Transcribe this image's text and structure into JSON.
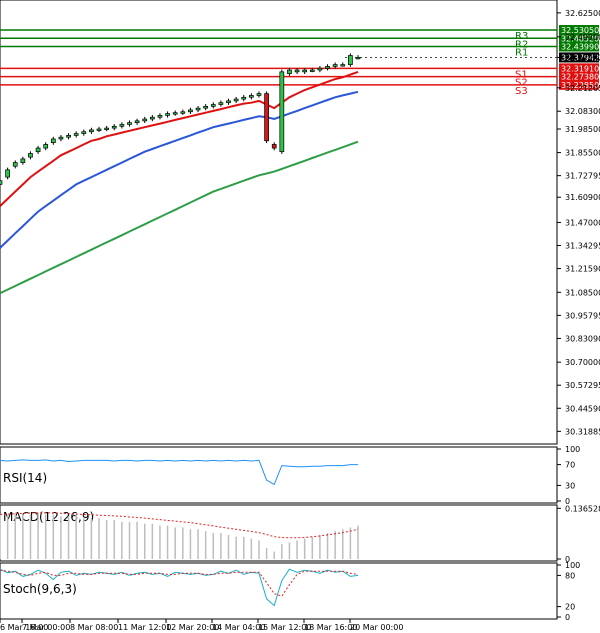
{
  "chart_data": {
    "type": "candlestick",
    "title": "",
    "main": {
      "ylim": [
        30.26,
        32.685
      ],
      "y_ticks": [
        "32.62500",
        "32.49300",
        "32.37942",
        "32.21205",
        "32.08300",
        "31.98500",
        "31.85500",
        "31.72795",
        "31.60900",
        "31.47000",
        "31.34295",
        "31.21590",
        "31.08500",
        "30.95795",
        "30.83090",
        "30.70000",
        "30.57295",
        "30.44590",
        "30.31885"
      ],
      "y_tick_values": [
        32.625,
        32.493,
        32.37942,
        32.21205,
        32.083,
        31.985,
        31.855,
        31.72795,
        31.609,
        31.47,
        31.34295,
        31.2159,
        31.085,
        30.95795,
        30.8309,
        30.7,
        30.57295,
        30.4459,
        30.31885
      ],
      "last_price": {
        "value": 32.37942,
        "label": "32.37942"
      },
      "levels": [
        {
          "name": "R3",
          "value": 32.5305,
          "label": "32.53050",
          "color": "#007a00"
        },
        {
          "name": "R2",
          "value": 32.4852,
          "label": "32.48520",
          "color": "#007a00"
        },
        {
          "name": "R1",
          "value": 32.4399,
          "label": "32.43990",
          "color": "#007a00"
        },
        {
          "name": "S1",
          "value": 32.3191,
          "label": "32.31910",
          "color": "#e01010"
        },
        {
          "name": "S2",
          "value": 32.2738,
          "label": "32.27380",
          "color": "#e01010"
        },
        {
          "name": "S3",
          "value": 32.2285,
          "label": "32.22850",
          "color": "#e01010"
        }
      ],
      "close": [
        31.7,
        31.76,
        31.8,
        31.82,
        31.85,
        31.88,
        31.9,
        31.93,
        31.94,
        31.95,
        31.96,
        31.97,
        31.98,
        31.985,
        31.99,
        32.0,
        32.01,
        32.02,
        32.03,
        32.04,
        32.05,
        32.06,
        32.07,
        32.075,
        32.08,
        32.09,
        32.1,
        32.11,
        32.12,
        32.13,
        32.14,
        32.15,
        32.16,
        32.17,
        32.18,
        31.92,
        31.88,
        32.3,
        32.31,
        32.31,
        32.31,
        32.31,
        32.32,
        32.33,
        32.34,
        32.34,
        32.39,
        32.38
      ],
      "open": [
        31.68,
        31.72,
        31.78,
        31.8,
        31.83,
        31.86,
        31.88,
        31.91,
        31.93,
        31.94,
        31.95,
        31.96,
        31.97,
        31.98,
        31.985,
        31.99,
        32.0,
        32.01,
        32.02,
        32.03,
        32.04,
        32.05,
        32.06,
        32.07,
        32.075,
        32.08,
        32.09,
        32.1,
        32.11,
        32.12,
        32.13,
        32.14,
        32.15,
        32.16,
        32.17,
        32.18,
        31.9,
        31.86,
        32.29,
        32.3,
        32.3,
        32.31,
        32.31,
        32.32,
        32.33,
        32.34,
        32.34,
        32.38
      ],
      "series": [
        {
          "name": "",
          "color": "#e01010",
          "values": [
            31.56,
            31.6,
            31.64,
            31.68,
            31.72,
            31.75,
            31.78,
            31.81,
            31.84,
            31.86,
            31.88,
            31.9,
            31.92,
            31.93,
            31.945,
            31.955,
            31.965,
            31.975,
            31.985,
            31.995,
            32.005,
            32.015,
            32.025,
            32.035,
            32.045,
            32.055,
            32.065,
            32.075,
            32.085,
            32.095,
            32.105,
            32.115,
            32.125,
            32.13,
            32.14,
            32.12,
            32.1,
            32.13,
            32.16,
            32.18,
            32.2,
            32.215,
            32.23,
            32.245,
            32.26,
            32.27,
            32.285,
            32.3
          ]
        },
        {
          "name": "",
          "color": "#2a56d8",
          "values": [
            31.33,
            31.37,
            31.41,
            31.45,
            31.49,
            31.53,
            31.56,
            31.59,
            31.62,
            31.65,
            31.68,
            31.7,
            31.72,
            31.74,
            31.76,
            31.78,
            31.8,
            31.82,
            31.84,
            31.86,
            31.875,
            31.89,
            31.905,
            31.92,
            31.935,
            31.95,
            31.965,
            31.98,
            31.995,
            32.005,
            32.015,
            32.025,
            32.035,
            32.045,
            32.055,
            32.05,
            32.04,
            32.055,
            32.07,
            32.085,
            32.1,
            32.115,
            32.13,
            32.145,
            32.16,
            32.17,
            32.18,
            32.19
          ]
        },
        {
          "name": "",
          "color": "#2e9e48",
          "values": [
            31.08,
            31.1,
            31.12,
            31.14,
            31.16,
            31.18,
            31.2,
            31.22,
            31.24,
            31.26,
            31.28,
            31.3,
            31.32,
            31.34,
            31.36,
            31.38,
            31.4,
            31.42,
            31.44,
            31.46,
            31.48,
            31.5,
            31.52,
            31.54,
            31.56,
            31.58,
            31.6,
            31.62,
            31.64,
            31.655,
            31.67,
            31.685,
            31.7,
            31.715,
            31.73,
            31.74,
            31.75,
            31.765,
            31.78,
            31.795,
            31.81,
            31.825,
            31.84,
            31.855,
            31.87,
            31.885,
            31.9,
            31.915
          ]
        }
      ]
    },
    "x_ticks": [
      "6 Mar 16:00",
      "7 Mar 00:00",
      "8 Mar 08:00",
      "11 Mar 12:00",
      "12 Mar 20:00",
      "14 Mar 04:00",
      "15 Mar 12:00",
      "18 Mar 16:00",
      "20 Mar 00:00"
    ],
    "rsi": {
      "label": "RSI(14)",
      "ylim": [
        0,
        100
      ],
      "y_ticks": [
        "100",
        "70",
        "30",
        "0"
      ],
      "y_tick_values": [
        100,
        70,
        30,
        0
      ],
      "values": [
        78,
        77,
        78,
        79,
        78,
        78,
        79,
        77,
        78,
        76,
        77,
        78,
        78,
        78,
        78,
        77,
        78,
        78,
        77,
        78,
        78,
        77,
        78,
        77,
        78,
        77,
        78,
        77,
        78,
        77,
        78,
        77,
        78,
        77,
        78,
        40,
        32,
        68,
        67,
        66,
        66,
        67,
        67,
        68,
        68,
        68,
        70,
        70
      ]
    },
    "macd": {
      "label": "MACD(12,26,9)",
      "ylim": [
        0,
        0.14
      ],
      "y_ticks": [
        "0.136528",
        "0"
      ],
      "y_tick_values": [
        0.136528,
        0
      ],
      "histogram": [
        0.12,
        0.12,
        0.125,
        0.12,
        0.12,
        0.125,
        0.12,
        0.12,
        0.115,
        0.115,
        0.12,
        0.11,
        0.11,
        0.11,
        0.105,
        0.105,
        0.1,
        0.1,
        0.1,
        0.095,
        0.095,
        0.09,
        0.09,
        0.085,
        0.085,
        0.08,
        0.08,
        0.075,
        0.07,
        0.07,
        0.065,
        0.06,
        0.06,
        0.055,
        0.05,
        0.03,
        0.02,
        0.04,
        0.045,
        0.05,
        0.055,
        0.06,
        0.065,
        0.07,
        0.075,
        0.08,
        0.085,
        0.09
      ],
      "signal": [
        0.12,
        0.121,
        0.122,
        0.123,
        0.124,
        0.124,
        0.124,
        0.124,
        0.123,
        0.122,
        0.121,
        0.12,
        0.119,
        0.118,
        0.117,
        0.116,
        0.115,
        0.113,
        0.112,
        0.11,
        0.108,
        0.106,
        0.104,
        0.102,
        0.1,
        0.098,
        0.095,
        0.092,
        0.089,
        0.086,
        0.083,
        0.08,
        0.077,
        0.074,
        0.071,
        0.066,
        0.06,
        0.058,
        0.057,
        0.057,
        0.058,
        0.06,
        0.062,
        0.065,
        0.068,
        0.071,
        0.075,
        0.08
      ]
    },
    "stoch": {
      "label": "Stoch(9,6,3)",
      "ylim": [
        0,
        100
      ],
      "y_ticks": [
        "100",
        "80",
        "20",
        "0"
      ],
      "y_tick_values": [
        100,
        80,
        20,
        0
      ],
      "k": [
        92,
        85,
        88,
        78,
        82,
        90,
        84,
        72,
        86,
        88,
        80,
        84,
        82,
        86,
        84,
        82,
        86,
        80,
        84,
        86,
        82,
        84,
        78,
        86,
        84,
        82,
        84,
        80,
        82,
        88,
        84,
        90,
        82,
        86,
        84,
        35,
        22,
        70,
        92,
        86,
        90,
        88,
        84,
        90,
        86,
        88,
        78,
        80
      ],
      "d": [
        90,
        88,
        86,
        82,
        80,
        84,
        86,
        80,
        80,
        84,
        84,
        82,
        82,
        84,
        84,
        84,
        84,
        82,
        82,
        84,
        84,
        84,
        82,
        82,
        84,
        84,
        84,
        82,
        82,
        84,
        84,
        86,
        86,
        86,
        86,
        66,
        45,
        40,
        62,
        82,
        88,
        88,
        88,
        88,
        88,
        88,
        84,
        82
      ]
    }
  }
}
